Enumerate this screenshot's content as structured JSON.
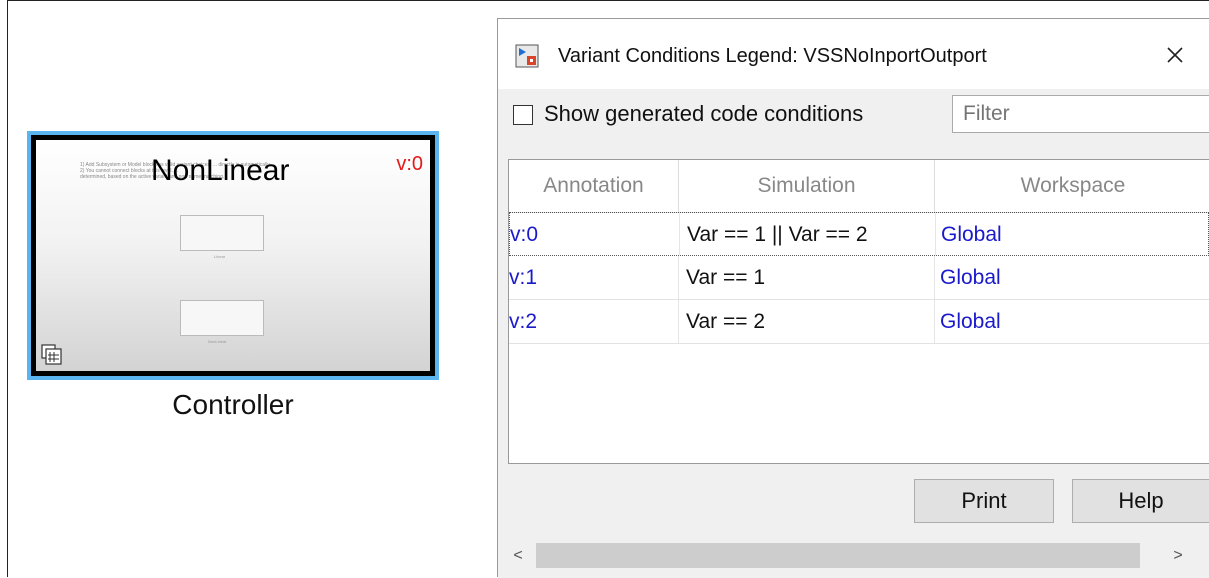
{
  "block": {
    "title": "NonLinear",
    "variant_annotation": "v:0",
    "caption": "Controller",
    "note_lines": [
      "1) Add Subsystem or Model blocks as valid variant choices. ... directly is automatically",
      "2) You cannot connect blocks at this level. ...",
      "determined, based on the active variant and port name matching."
    ],
    "inner_labels": [
      "Linear",
      "NonLinear"
    ]
  },
  "dialog": {
    "title": "Variant Conditions Legend: VSSNoInportOutport",
    "show_generated_label": "Show generated code conditions",
    "filter_placeholder": "Filter",
    "columns": [
      "Annotation",
      "Simulation",
      "Workspace"
    ],
    "rows": [
      {
        "annotation": "v:0",
        "simulation": "Var == 1 || Var == 2",
        "workspace": "Global"
      },
      {
        "annotation": "v:1",
        "simulation": "Var == 1",
        "workspace": "Global"
      },
      {
        "annotation": "v:2",
        "simulation": "Var == 2",
        "workspace": "Global"
      }
    ],
    "print_label": "Print",
    "help_label": "Help",
    "scroll_left": "<",
    "scroll_right": ">"
  },
  "colors": {
    "annotation_text": "#1a1acc",
    "variant_tag": "#e51919",
    "block_highlight": "#5ab4f0"
  }
}
